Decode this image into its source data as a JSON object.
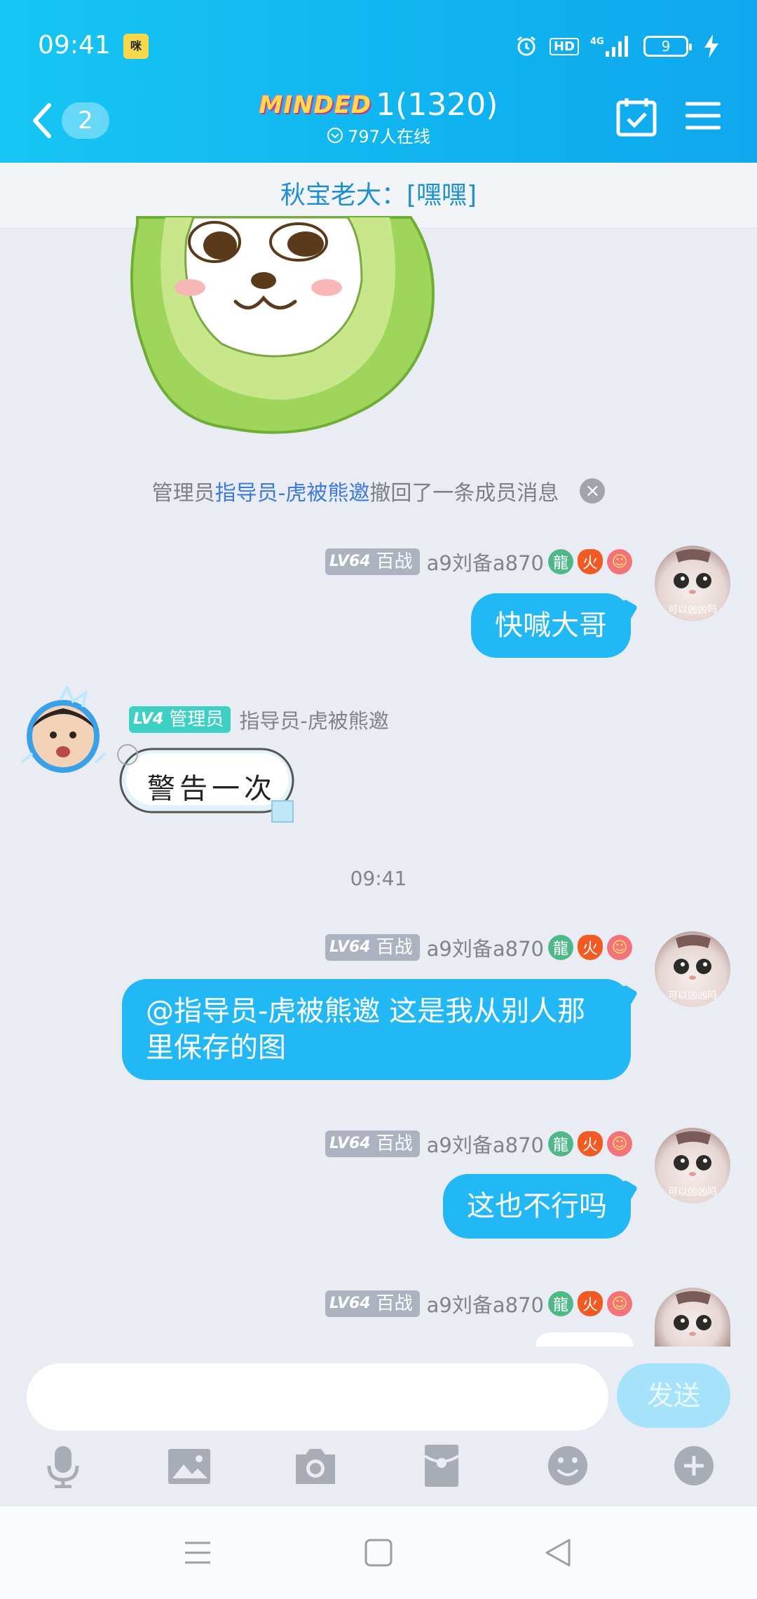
{
  "status": {
    "time": "09:41",
    "app_icon_text": "咪",
    "hd": "HD",
    "network": "4G",
    "battery": "9"
  },
  "header": {
    "back_count": "2",
    "logo": "MINDED",
    "title": "1(1320)",
    "online": "797人在线"
  },
  "announcement": "秋宝老大：[嘿嘿]",
  "system_message": {
    "prefix": "管理员",
    "admin_name": "指导员-虎被熊邀",
    "suffix": "撤回了一条成员消息"
  },
  "sender_me": {
    "level": "LV64",
    "title": "百战",
    "nickname": "a9刘备a870"
  },
  "sender_admin": {
    "level": "LV4",
    "title": "管理员",
    "nickname": "指导员-虎被熊邀",
    "sticker_text": "警告一次"
  },
  "messages": [
    {
      "text": "快喊大哥"
    },
    {
      "text": "@指导员-虎被熊邀 这是我从别人那里保存的图"
    },
    {
      "text": "这也不行吗"
    }
  ],
  "time_divider": "09:41",
  "avatar_caption": "可以凶凶吗",
  "input": {
    "placeholder": "",
    "send_label": "发送"
  },
  "toolbar_icons": [
    "microphone-icon",
    "image-icon",
    "camera-icon",
    "red-packet-icon",
    "emoji-icon",
    "plus-icon"
  ],
  "colors": {
    "header": "#0fb3f0",
    "bubble": "#22b7f5",
    "admin_badge": "#3ed0c4"
  }
}
